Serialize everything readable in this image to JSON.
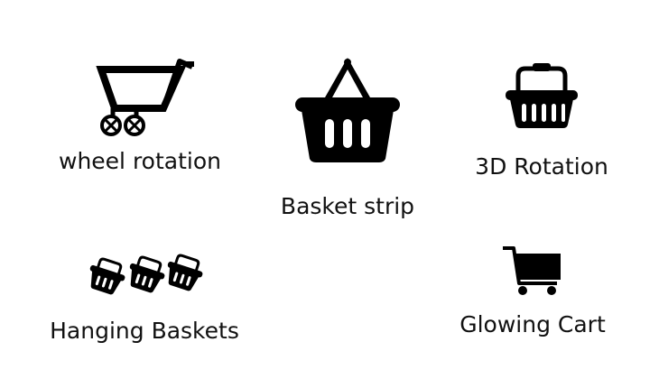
{
  "items": [
    {
      "label": "wheel rotation",
      "icon": "shopping-cart-outline-icon"
    },
    {
      "label": "Basket strip",
      "icon": "hanging-basket-icon"
    },
    {
      "label": "3D Rotation",
      "icon": "basket-handle-icon"
    },
    {
      "label": "Hanging Baskets",
      "icon": "three-tilted-baskets-icon"
    },
    {
      "label": "Glowing Cart",
      "icon": "shopping-cart-filled-icon"
    }
  ],
  "colors": {
    "icon": "#000000",
    "text": "#111111",
    "background": "#ffffff"
  }
}
